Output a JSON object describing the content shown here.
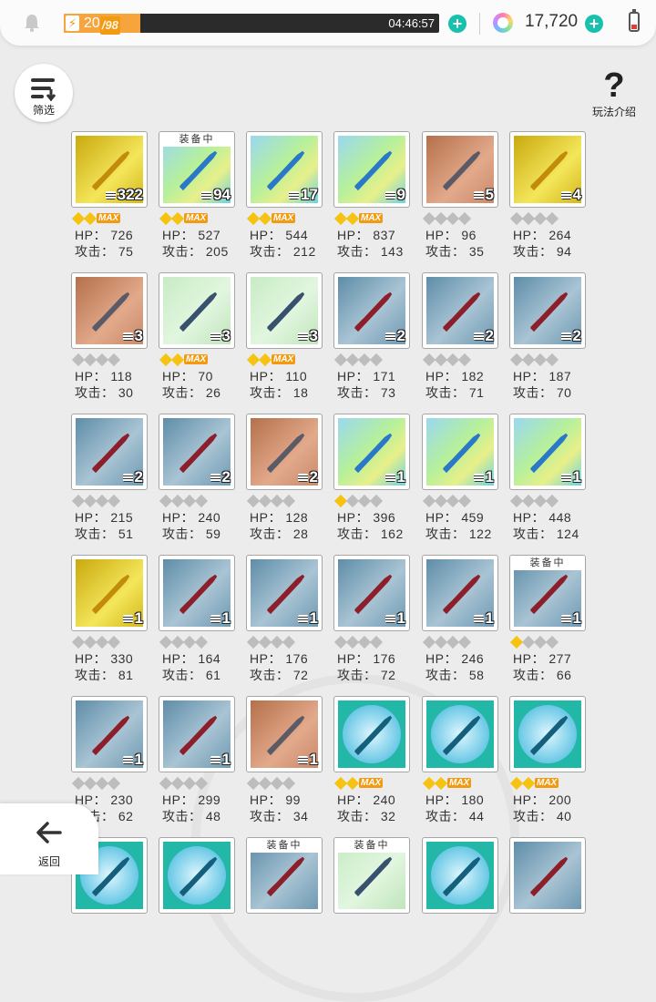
{
  "topbar": {
    "energy_current": "20",
    "energy_max": "/98",
    "energy_fraction": 0.204,
    "timer": "04:46:57",
    "coins": "17,720"
  },
  "buttons": {
    "filter_label": "筛选",
    "help_label": "玩法介绍",
    "back_label": "返回"
  },
  "labels": {
    "hp": "HP：",
    "atk": "攻击：",
    "equipped": "装备中",
    "max": "MAX"
  },
  "colors": {
    "accent": "#19c1ad",
    "energy": "#f8a43c",
    "star": "#f7c313"
  },
  "items": [
    {
      "icon": "gold-medallion-icon",
      "bg": "gold",
      "count": "322",
      "stars": 2,
      "max": true,
      "hp": "726",
      "atk": "75",
      "equipped": false
    },
    {
      "icon": "blue-fish-sword-icon",
      "bg": "rainbow",
      "count": "94",
      "stars": 2,
      "max": true,
      "hp": "527",
      "atk": "205",
      "equipped": true
    },
    {
      "icon": "crystal-spear-icon",
      "bg": "rainbow",
      "count": "17",
      "stars": 2,
      "max": true,
      "hp": "544",
      "atk": "212",
      "equipped": false
    },
    {
      "icon": "purple-shield-icon",
      "bg": "rainbow",
      "count": "9",
      "stars": 2,
      "max": true,
      "hp": "837",
      "atk": "143",
      "equipped": false
    },
    {
      "icon": "broad-sword-icon",
      "bg": "copper",
      "count": "5",
      "stars": 0,
      "max": false,
      "hp": "96",
      "atk": "35",
      "equipped": false
    },
    {
      "icon": "red-dagger-icon",
      "bg": "gold",
      "count": "4",
      "stars": 0,
      "max": false,
      "hp": "264",
      "atk": "94",
      "equipped": false
    },
    {
      "icon": "blue-gauntlet-icon",
      "bg": "copper",
      "count": "3",
      "stars": 0,
      "max": false,
      "hp": "118",
      "atk": "30",
      "equipped": false
    },
    {
      "icon": "short-sword-icon",
      "bg": "mint",
      "count": "3",
      "stars": 2,
      "max": true,
      "hp": "70",
      "atk": "26",
      "equipped": false
    },
    {
      "icon": "kite-shield-icon",
      "bg": "mint",
      "count": "3",
      "stars": 2,
      "max": true,
      "hp": "110",
      "atk": "18",
      "equipped": false
    },
    {
      "icon": "lightning-staff-icon",
      "bg": "steel",
      "count": "2",
      "stars": 0,
      "max": false,
      "hp": "171",
      "atk": "73",
      "equipped": false
    },
    {
      "icon": "battle-axe-icon",
      "bg": "steel",
      "count": "2",
      "stars": 0,
      "max": false,
      "hp": "182",
      "atk": "71",
      "equipped": false
    },
    {
      "icon": "long-spear-icon",
      "bg": "steel",
      "count": "2",
      "stars": 0,
      "max": false,
      "hp": "187",
      "atk": "70",
      "equipped": false
    },
    {
      "icon": "pickaxe-icon",
      "bg": "steel",
      "count": "2",
      "stars": 0,
      "max": false,
      "hp": "215",
      "atk": "51",
      "equipped": false
    },
    {
      "icon": "magic-wand-icon",
      "bg": "steel",
      "count": "2",
      "stars": 0,
      "max": false,
      "hp": "240",
      "atk": "59",
      "equipped": false
    },
    {
      "icon": "wooden-bow-icon",
      "bg": "copper",
      "count": "2",
      "stars": 0,
      "max": false,
      "hp": "128",
      "atk": "28",
      "equipped": false
    },
    {
      "icon": "ice-sword-icon",
      "bg": "rainbow",
      "count": "1",
      "stars": 1,
      "max": false,
      "hp": "396",
      "atk": "162",
      "equipped": false
    },
    {
      "icon": "crescent-bow-icon",
      "bg": "rainbow",
      "count": "1",
      "stars": 0,
      "max": false,
      "hp": "459",
      "atk": "122",
      "equipped": false
    },
    {
      "icon": "golden-disc-icon",
      "bg": "rainbow",
      "count": "1",
      "stars": 0,
      "max": false,
      "hp": "448",
      "atk": "124",
      "equipped": false
    },
    {
      "icon": "red-glove-icon",
      "bg": "gold",
      "count": "1",
      "stars": 0,
      "max": false,
      "hp": "330",
      "atk": "81",
      "equipped": false
    },
    {
      "icon": "red-spear-icon",
      "bg": "steel",
      "count": "1",
      "stars": 0,
      "max": false,
      "hp": "164",
      "atk": "61",
      "equipped": false
    },
    {
      "icon": "scythe-icon",
      "bg": "steel",
      "count": "1",
      "stars": 0,
      "max": false,
      "hp": "176",
      "atk": "72",
      "equipped": false
    },
    {
      "icon": "feather-lance-icon",
      "bg": "steel",
      "count": "1",
      "stars": 0,
      "max": false,
      "hp": "176",
      "atk": "72",
      "equipped": false
    },
    {
      "icon": "crossbow-icon",
      "bg": "steel",
      "count": "1",
      "stars": 0,
      "max": false,
      "hp": "246",
      "atk": "58",
      "equipped": false
    },
    {
      "icon": "spell-book-icon",
      "bg": "steel",
      "count": "1",
      "stars": 1,
      "max": false,
      "hp": "277",
      "atk": "66",
      "equipped": true
    },
    {
      "icon": "red-armor-icon",
      "bg": "steel",
      "count": "1",
      "stars": 0,
      "max": false,
      "hp": "230",
      "atk": "62",
      "equipped": false
    },
    {
      "icon": "blue-amulet-icon",
      "bg": "steel",
      "count": "1",
      "stars": 0,
      "max": false,
      "hp": "299",
      "atk": "48",
      "equipped": false
    },
    {
      "icon": "trident-icon",
      "bg": "copper",
      "count": "1",
      "stars": 0,
      "max": false,
      "hp": "99",
      "atk": "34",
      "equipped": false
    },
    {
      "icon": "green-orb-icon",
      "bg": "teal",
      "count": "",
      "stars": 2,
      "max": true,
      "hp": "240",
      "atk": "32",
      "equipped": false
    },
    {
      "icon": "golden-cloud-orb-icon",
      "bg": "teal",
      "count": "",
      "stars": 2,
      "max": true,
      "hp": "180",
      "atk": "44",
      "equipped": false
    },
    {
      "icon": "ship-orb-icon",
      "bg": "teal",
      "count": "",
      "stars": 2,
      "max": true,
      "hp": "200",
      "atk": "40",
      "equipped": false
    },
    {
      "icon": "green-orb-partial-icon",
      "bg": "teal",
      "count": "",
      "stars": 0,
      "max": false,
      "hp": "",
      "atk": "",
      "equipped": false
    },
    {
      "icon": "blue-crystal-orb-icon",
      "bg": "teal",
      "count": "",
      "stars": 0,
      "max": false,
      "hp": "",
      "atk": "",
      "equipped": false
    },
    {
      "icon": "purple-orb-icon",
      "bg": "steel",
      "count": "",
      "stars": 0,
      "max": false,
      "hp": "",
      "atk": "",
      "equipped": true
    },
    {
      "icon": "dark-orb-icon",
      "bg": "mint",
      "count": "",
      "stars": 0,
      "max": false,
      "hp": "",
      "atk": "",
      "equipped": true
    },
    {
      "icon": "teal-gem-icon",
      "bg": "teal",
      "count": "",
      "stars": 0,
      "max": false,
      "hp": "",
      "atk": "",
      "equipped": false
    },
    {
      "icon": "violet-sword-icon",
      "bg": "steel",
      "count": "",
      "stars": 0,
      "max": false,
      "hp": "",
      "atk": "",
      "equipped": false
    }
  ]
}
